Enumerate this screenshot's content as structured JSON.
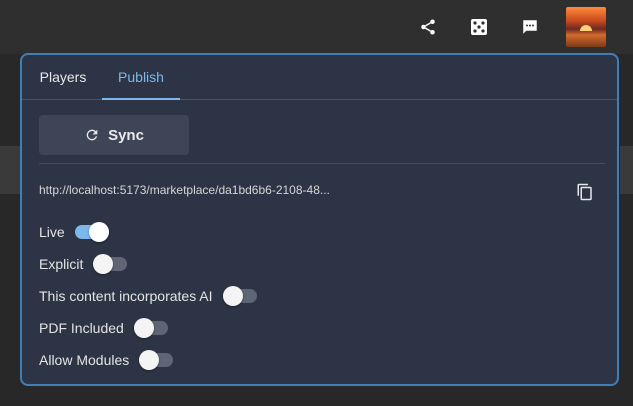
{
  "topbar": {
    "icons": [
      "share-icon",
      "dice-icon",
      "chat-icon"
    ],
    "avatar": "sunset-avatar"
  },
  "panel": {
    "tabs": [
      {
        "label": "Players",
        "active": false
      },
      {
        "label": "Publish",
        "active": true
      }
    ],
    "sync_label": "Sync",
    "url": "http://localhost:5173/marketplace/da1bd6b6-2108-48...",
    "toggles": [
      {
        "label": "Live",
        "on": true
      },
      {
        "label": "Explicit",
        "on": false
      },
      {
        "label": "This content incorporates AI",
        "on": false
      },
      {
        "label": "PDF Included",
        "on": false
      },
      {
        "label": "Allow Modules",
        "on": false
      }
    ]
  },
  "colors": {
    "accent": "#7cb8ec",
    "panel_bg": "#2c3445",
    "border": "#3f7fb8"
  }
}
